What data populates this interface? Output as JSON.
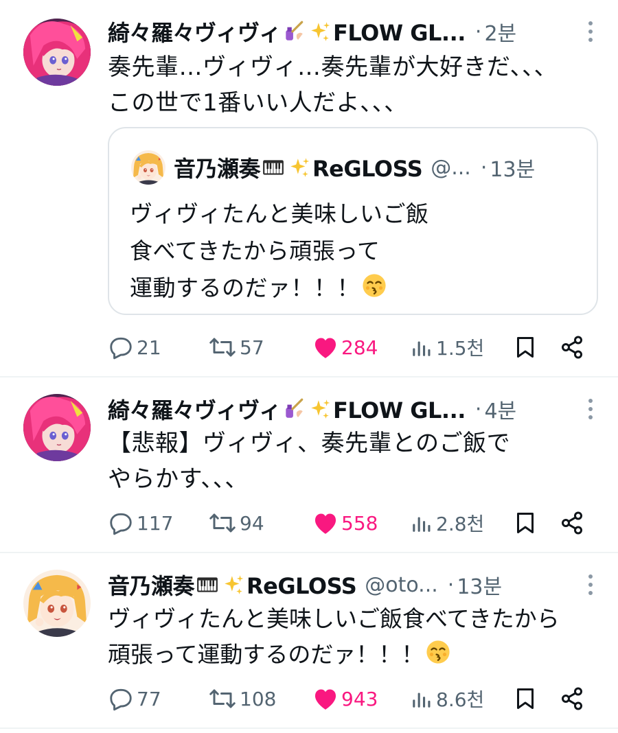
{
  "icons": {
    "reply": "speech-bubble-icon",
    "retweet": "retweet-icon",
    "like": "heart-icon",
    "views": "bar-chart-icon",
    "bookmark": "bookmark-icon",
    "share": "share-icon",
    "more": "vertical-dots-icon",
    "nail": "nail-polish-emoji",
    "sparkles": "sparkles-emoji",
    "piano": "piano-keys-emoji",
    "kiss": "kissing-face-emoji"
  },
  "colors": {
    "like": "#f91880",
    "muted": "#536471",
    "text": "#0f1419",
    "border": "#dfe4e8"
  },
  "tweets": [
    {
      "name_prefix": "綺々羅々ヴィヴィ",
      "name_suffix": "FLOW GL...",
      "handle": "",
      "dot": "·",
      "time": "2분",
      "text": "奏先輩…ヴィヴィ…奏先輩が大好きだ、、、\nこの世で1番いい人だよ、、、",
      "quote": {
        "name_prefix": "音乃瀬奏",
        "name_suffix": "ReGLOSS",
        "handle": "@...",
        "dot": "·",
        "time": "13분",
        "text": "ヴィヴィたんと美味しいご飯\n食べてきたから頑張って\n運動するのだァ！！！"
      },
      "replies": "21",
      "retweets": "57",
      "likes": "284",
      "views": "1.5천"
    },
    {
      "name_prefix": "綺々羅々ヴィヴィ",
      "name_suffix": "FLOW GL...",
      "handle": "",
      "dot": "·",
      "time": "4분",
      "text": "【悲報】ヴィヴィ、奏先輩とのご飯で\nやらかす、、、",
      "replies": "117",
      "retweets": "94",
      "likes": "558",
      "views": "2.8천"
    },
    {
      "name_prefix": "音乃瀬奏",
      "name_suffix": "ReGLOSS",
      "handle": "@oto...",
      "dot": "·",
      "time": "13분",
      "text_line1": "ヴィヴィたんと美味しいご飯食べてきたから",
      "text_line2": "頑張って運動するのだァ！！！",
      "replies": "77",
      "retweets": "108",
      "likes": "943",
      "views": "8.6천"
    }
  ]
}
